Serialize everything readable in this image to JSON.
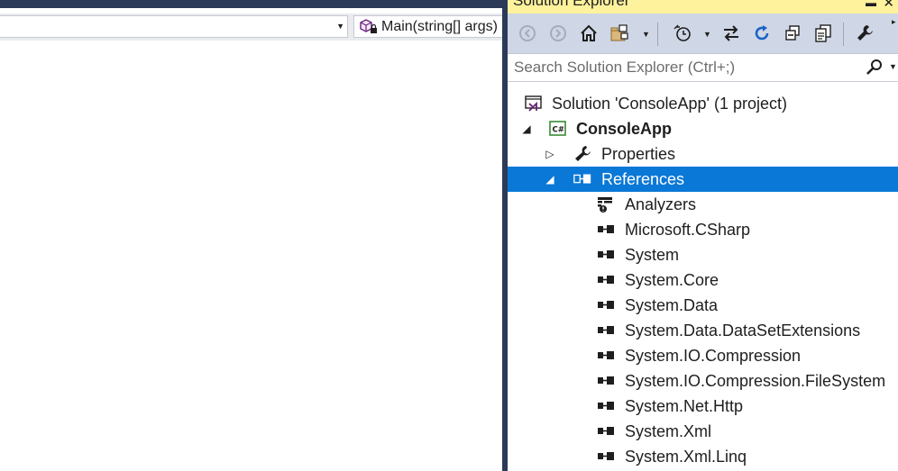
{
  "editor": {
    "member_combo": "Main(string[] args)"
  },
  "solution_explorer": {
    "title": "Solution Explorer",
    "search_placeholder": "Search Solution Explorer (Ctrl+;)",
    "toolbar_icons": [
      "back-icon",
      "forward-icon",
      "home-icon",
      "switch-views-icon",
      "pending-changes-icon",
      "sync-icon",
      "refresh-icon",
      "collapse-all-icon",
      "show-all-files-icon",
      "properties-wrench-icon"
    ],
    "tree": {
      "solution": "Solution 'ConsoleApp' (1 project)",
      "project": "ConsoleApp",
      "properties": "Properties",
      "references": "References",
      "reference_items": [
        "Analyzers",
        "Microsoft.CSharp",
        "System",
        "System.Core",
        "System.Data",
        "System.Data.DataSetExtensions",
        "System.IO.Compression",
        "System.IO.Compression.FileSystem",
        "System.Net.Http",
        "System.Xml",
        "System.Xml.Linq"
      ]
    }
  },
  "colors": {
    "selection": "#0a78d7",
    "title_highlight": "#fff29d",
    "toolbar_bg": "#cfd6e5",
    "frame_dark": "#2b3a58",
    "csharp_green": "#388a34",
    "vs_purple": "#68217a"
  }
}
